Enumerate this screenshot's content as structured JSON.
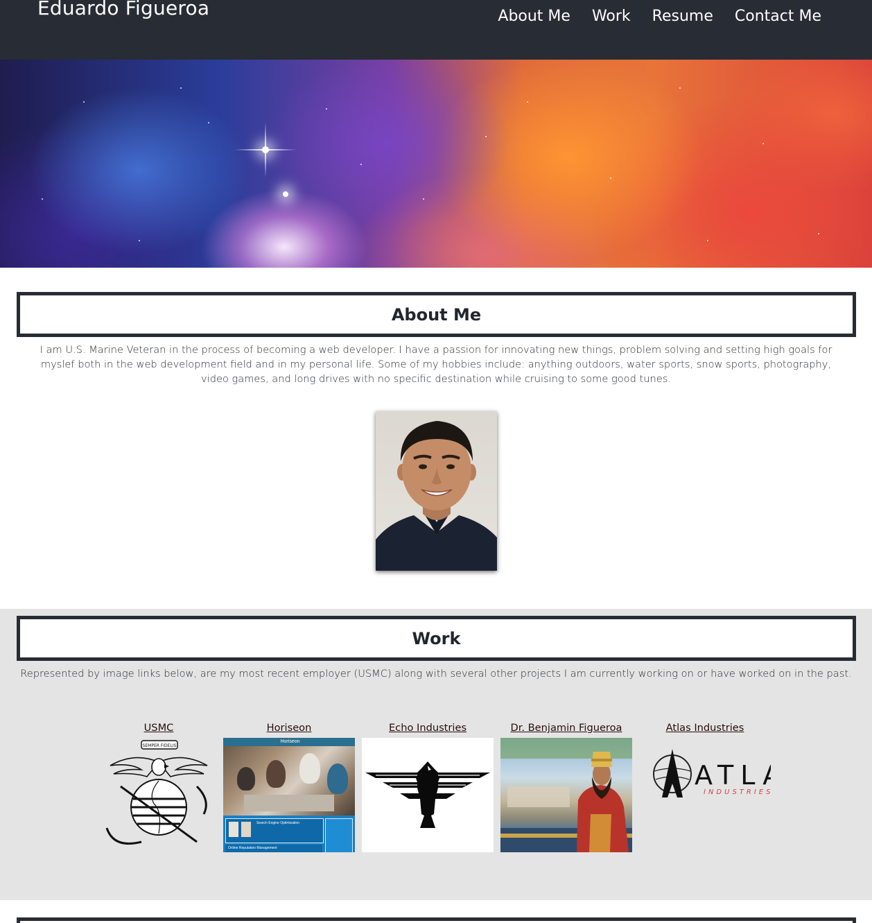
{
  "header": {
    "site_title": "Eduardo Figueroa",
    "nav": [
      {
        "label": "About Me"
      },
      {
        "label": "Work"
      },
      {
        "label": "Resume"
      },
      {
        "label": "Contact Me"
      }
    ]
  },
  "about": {
    "heading": "About Me",
    "body": "I am U.S. Marine Veteran in the process of becoming a web developer. I have a passion for innovating new things, problem solving and setting high goals for myslef both in the web development field and in my personal life. Some of my hobbies include: anything outdoors, water sports, snow sports, photography, video games, and long drives with no specific destination while cruising to some good tunes."
  },
  "work": {
    "heading": "Work",
    "intro": "Represented by image links below, are my most recent employer (USMC) along with several other projects I am currently working on or have worked on in the past.",
    "projects": [
      {
        "label": "USMC"
      },
      {
        "label": "Horiseon"
      },
      {
        "label": "Echo Industries"
      },
      {
        "label": "Dr. Benjamin Figueroa"
      },
      {
        "label": "Atlas Industries"
      }
    ],
    "horiseon_thumb": {
      "brand": "Horiseon",
      "card_title": "Search Engine Optimization",
      "card_title_2": "Online Reputation Management"
    },
    "usmc_thumb": {
      "motto": "SEMPER FIDELIS"
    },
    "atlas_thumb": {
      "wordmark": "ATLAS",
      "subline": "INDUSTRIES"
    }
  },
  "colors": {
    "header_bg": "#282c35",
    "work_bg": "#e4e4e4",
    "text": "#22252d",
    "link": "#2a0d0d",
    "atlas_accent": "#d0404a"
  }
}
